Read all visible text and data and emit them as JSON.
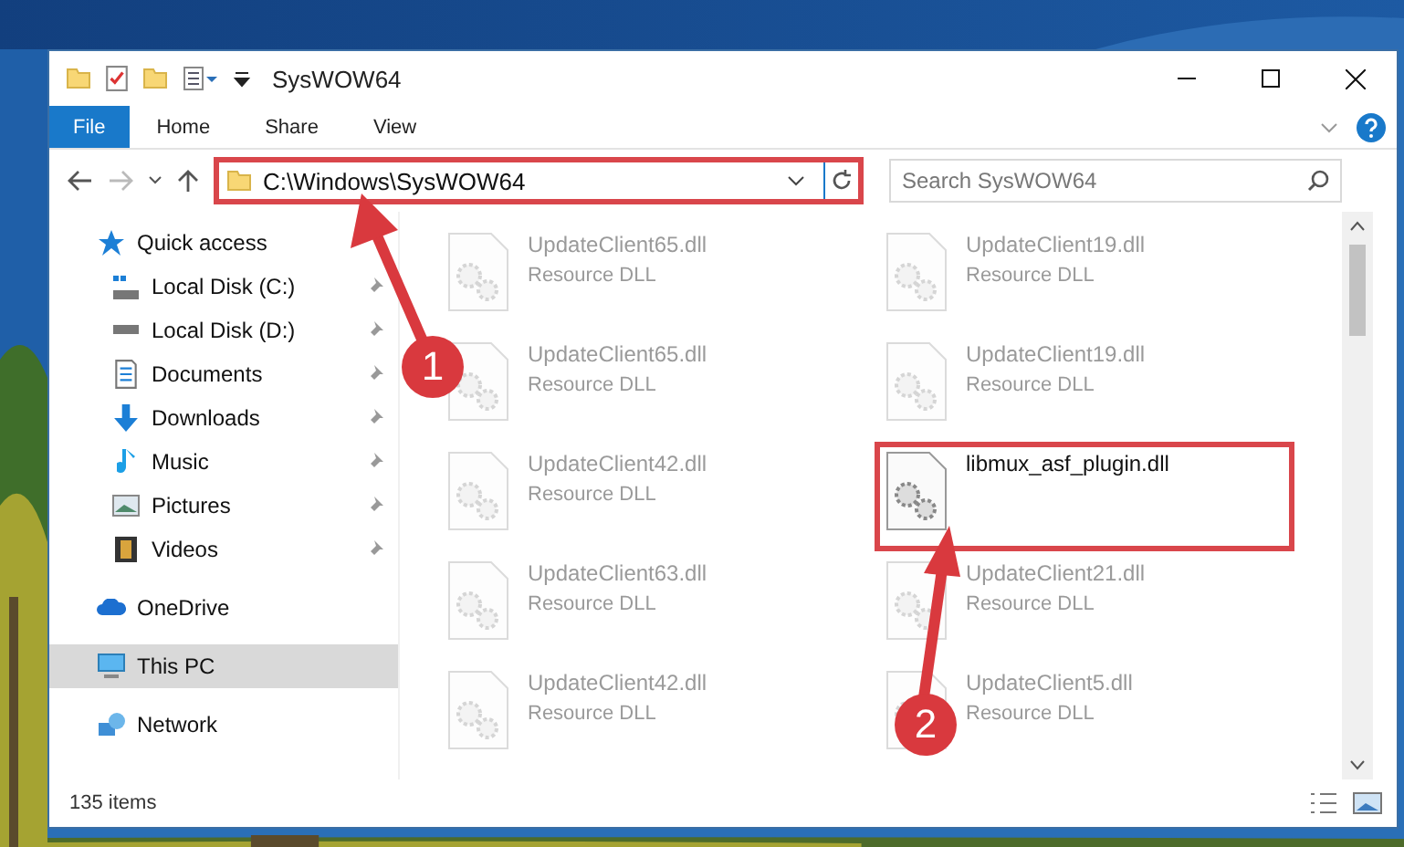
{
  "window": {
    "title": "SysWOW64"
  },
  "ribbon_tabs": [
    {
      "label": "File",
      "kind": "menu",
      "selected": false
    },
    {
      "label": "Home",
      "kind": "tab",
      "selected": false
    },
    {
      "label": "Share",
      "kind": "tab",
      "selected": false
    },
    {
      "label": "View",
      "kind": "tab",
      "selected": false
    }
  ],
  "address": {
    "path": "C:\\Windows\\SysWOW64",
    "highlighted": true
  },
  "search": {
    "placeholder": "Search SysWOW64"
  },
  "navigation": [
    {
      "label": "Quick access",
      "selected": false,
      "children": [
        {
          "label": "Local Disk (C:)",
          "pinned": true,
          "selected": false
        },
        {
          "label": "Local Disk (D:)",
          "pinned": true,
          "selected": false
        },
        {
          "label": "Documents",
          "pinned": true,
          "selected": false
        },
        {
          "label": "Downloads",
          "pinned": true,
          "selected": false
        },
        {
          "label": "Music",
          "pinned": true,
          "selected": false
        },
        {
          "label": "Pictures",
          "pinned": true,
          "selected": false
        },
        {
          "label": "Videos",
          "pinned": true,
          "selected": false
        }
      ]
    },
    {
      "label": "OneDrive",
      "selected": false
    },
    {
      "label": "This PC",
      "selected": true
    },
    {
      "label": "Network",
      "selected": false
    }
  ],
  "files": [
    {
      "name": "UpdateClient65.dll",
      "type": "Resource DLL",
      "highlighted": false
    },
    {
      "name": "UpdateClient19.dll",
      "type": "Resource DLL",
      "highlighted": false
    },
    {
      "name": "UpdateClient65.dll",
      "type": "Resource DLL",
      "highlighted": false
    },
    {
      "name": "UpdateClient19.dll",
      "type": "Resource DLL",
      "highlighted": false
    },
    {
      "name": "UpdateClient42.dll",
      "type": "Resource DLL",
      "highlighted": false
    },
    {
      "name": "libmux_asf_plugin.dll",
      "highlighted": true
    },
    {
      "name": "UpdateClient63.dll",
      "type": "Resource DLL",
      "highlighted": false
    },
    {
      "name": "UpdateClient21.dll",
      "type": "Resource DLL",
      "highlighted": false
    },
    {
      "name": "UpdateClient42.dll",
      "type": "Resource DLL",
      "highlighted": false
    },
    {
      "name": "UpdateClient5.dll",
      "type": "Resource DLL",
      "highlighted": false
    }
  ],
  "status_bar": {
    "item_count": "135 items"
  },
  "callouts": [
    {
      "number": "1"
    },
    {
      "number": "2"
    }
  ]
}
